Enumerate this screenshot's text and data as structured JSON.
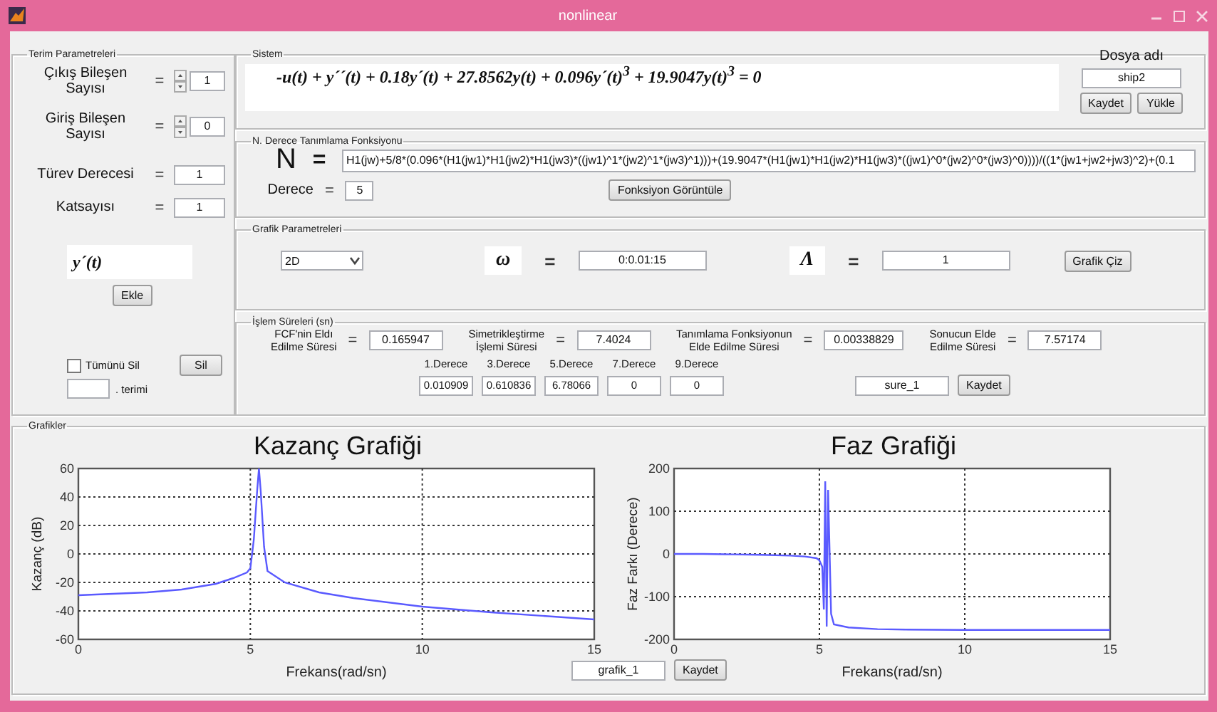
{
  "window": {
    "title": "nonlinear"
  },
  "term_parameters": {
    "title": "Terim Parametreleri",
    "rows": [
      {
        "kind": "spinner",
        "label": "Çıkış Bileşen\nSayısı",
        "sign": "=",
        "value": "1"
      },
      {
        "kind": "spinner",
        "label": "Giriş Bileşen\nSayısı",
        "sign": "=",
        "value": "0"
      },
      {
        "kind": "field",
        "label": "Türev Derecesi",
        "sign": "=",
        "value": "1"
      },
      {
        "kind": "field",
        "label": "Katsayısı",
        "sign": "=",
        "value": "1"
      }
    ],
    "preview": "y´(t)",
    "add_button": "Ekle",
    "delete_all": {
      "label": "Tümünü Sil",
      "checked": false
    },
    "delete_button": "Sil",
    "term_suffix": ". terimi"
  },
  "system": {
    "title": "Sistem",
    "equation": "-u(t) + y´´(t) + 0.18y´(t) + 27.8562y(t) + 0.096y´(t)$^{3}$ + 19.9047y(t)$^{3}$ = 0",
    "file_label": "Dosya adı",
    "file_name": "ship2",
    "save_button": "Kaydet",
    "load_button": "Yükle"
  },
  "identification": {
    "title": "N. Derece Tanımlama Fonksiyonu",
    "symbol": "N",
    "sign": "=",
    "function": "H1(jw)+5/8*(0.096*(H1(jw1)*H1(jw2)*H1(jw3)*((jw1)^1*(jw2)^1*(jw3)^1)))+(19.9047*(H1(jw1)*H1(jw2)*H1(jw3)*((jw1)^0*(jw2)^0*(jw3)^0))))/((1*(jw1+jw2+jw3)^2)+(0.1",
    "degree_label": "Derece",
    "degree_sign": "=",
    "degree": "5",
    "button": "Fonksiyon Görüntüle"
  },
  "graph_parameters": {
    "title": "Grafik Parametreleri",
    "mode": "2D",
    "omega": {
      "symbol": "ω",
      "sign": "=",
      "value": "0:0.01:15"
    },
    "lambda": {
      "symbol": "Λ",
      "sign": "=",
      "value": "1"
    },
    "button": "Grafik Çiz"
  },
  "timings": {
    "title": "İşlem Süreleri (sn)",
    "items": [
      {
        "label": "FCF'nin Eldı\nEdilme Süresi",
        "sign": "=",
        "value": "0.165947"
      },
      {
        "label": "Simetrikleştirme\nİşlemi Süresi",
        "sign": "=",
        "value": "7.4024"
      },
      {
        "label": "Tanımlama Fonksiyonun\nElde Edilme Süresi",
        "sign": "=",
        "value": "0.00338829"
      },
      {
        "label": "Sonucun Elde\nEdilme Süresi",
        "sign": "=",
        "value": "7.57174"
      }
    ],
    "degrees": [
      {
        "label": "1.Derece",
        "value": "0.010909"
      },
      {
        "label": "3.Derece",
        "value": "0.610836"
      },
      {
        "label": "5.Derece",
        "value": "6.78066"
      },
      {
        "label": "7.Derece",
        "value": "0"
      },
      {
        "label": "9.Derece",
        "value": "0"
      }
    ],
    "save_name": "sure_1",
    "save_button": "Kaydet"
  },
  "graphs": {
    "title": "Grafikler",
    "file_name": "grafik_1",
    "button": "Kaydet",
    "charts": [
      {
        "chart_data": {
          "type": "line",
          "title": "Kazanç Grafiği",
          "xlabel": "Frekans(rad/sn)",
          "ylabel": "Kazanç (dB)",
          "x": [
            0,
            1,
            2,
            3,
            4,
            4.5,
            4.9,
            5.0,
            5.1,
            5.2,
            5.25,
            5.3,
            5.4,
            5.5,
            6,
            7,
            8,
            10,
            12,
            15
          ],
          "series": [
            {
              "color": "#5a5aff",
              "values": [
                -29,
                -28,
                -27,
                -25,
                -21,
                -17,
                -13,
                -10,
                10,
                45,
                60,
                45,
                5,
                -12,
                -20,
                -27,
                -31,
                -37,
                -41,
                -46
              ]
            }
          ],
          "grid": true,
          "xlim": [
            0,
            15
          ],
          "ylim": [
            -60,
            60
          ],
          "xticks": [
            0,
            5,
            10,
            15
          ],
          "yticks": [
            -60,
            -40,
            -20,
            0,
            20,
            40,
            60
          ]
        }
      },
      {
        "chart_data": {
          "type": "line",
          "title": "Faz Grafiği",
          "xlabel": "Frekans(rad/sn)",
          "ylabel": "Faz Farkı (Derece)",
          "x": [
            0,
            1,
            2,
            3,
            4,
            4.5,
            4.9,
            5.0,
            5.1,
            5.15,
            5.2,
            5.25,
            5.3,
            5.4,
            5.5,
            6,
            7,
            8,
            10,
            12,
            15
          ],
          "series": [
            {
              "color": "#5a5aff",
              "values": [
                0,
                0,
                -1,
                -2,
                -4,
                -6,
                -10,
                -15,
                -30,
                -130,
                170,
                -170,
                150,
                -140,
                -165,
                -172,
                -176,
                -177,
                -178,
                -178,
                -178
              ]
            }
          ],
          "grid": true,
          "xlim": [
            0,
            15
          ],
          "ylim": [
            -200,
            200
          ],
          "xticks": [
            0,
            5,
            10,
            15
          ],
          "yticks": [
            -200,
            -100,
            0,
            100,
            200
          ]
        }
      }
    ]
  }
}
